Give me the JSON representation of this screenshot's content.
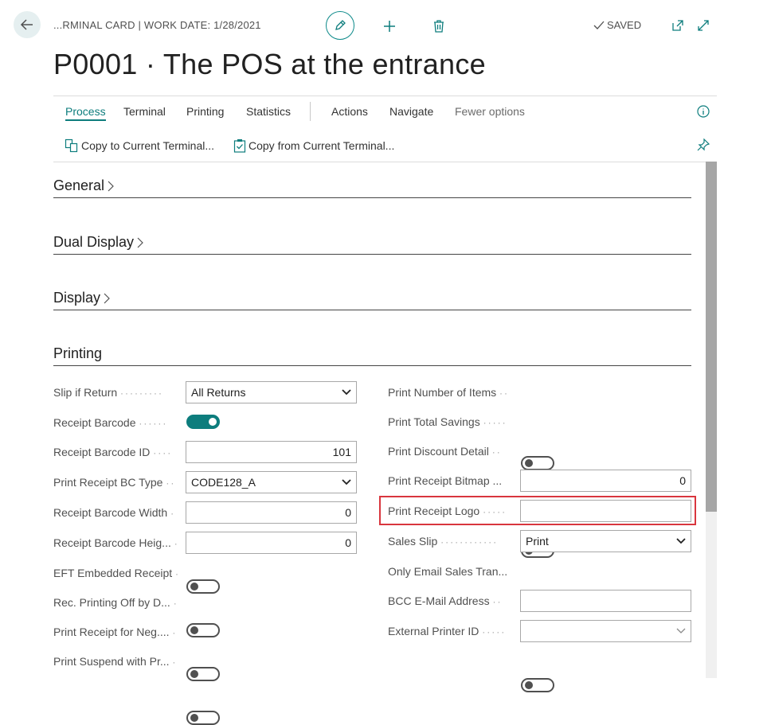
{
  "header": {
    "breadcrumb": "...RMINAL CARD | WORK DATE: 1/28/2021",
    "saved_label": "SAVED",
    "title": "P0001 · The POS at the entrance"
  },
  "menu": {
    "items": [
      "Process",
      "Terminal",
      "Printing",
      "Statistics",
      "Actions",
      "Navigate",
      "Fewer options"
    ],
    "active": "Process"
  },
  "actions": {
    "copy_to": "Copy to Current Terminal...",
    "copy_from": "Copy from Current Terminal..."
  },
  "sections": {
    "general": "General",
    "dual_display": "Dual Display",
    "display": "Display",
    "printing": "Printing"
  },
  "printing_left": [
    {
      "label": "Slip if Return",
      "type": "select",
      "value": "All Returns"
    },
    {
      "label": "Receipt Barcode",
      "type": "toggle",
      "value": "on"
    },
    {
      "label": "Receipt Barcode ID",
      "type": "number",
      "value": "101"
    },
    {
      "label": "Print Receipt BC Type",
      "type": "select",
      "value": "CODE128_A"
    },
    {
      "label": "Receipt Barcode Width",
      "type": "number",
      "value": "0"
    },
    {
      "label": "Receipt Barcode Heig...",
      "type": "number",
      "value": "0"
    },
    {
      "label": "EFT Embedded Receipt",
      "type": "toggle",
      "value": "off"
    },
    {
      "label": "Rec. Printing Off by D...",
      "type": "toggle",
      "value": "off"
    },
    {
      "label": "Print Receipt for Neg....",
      "type": "toggle",
      "value": "off"
    },
    {
      "label": "Print Suspend with Pr...",
      "type": "toggle",
      "value": "off"
    }
  ],
  "printing_right": [
    {
      "label": "Print Number of Items",
      "type": "toggle",
      "value": "off"
    },
    {
      "label": "Print Total Savings",
      "type": "toggle",
      "value": "off"
    },
    {
      "label": "Print Discount Detail",
      "type": "toggle",
      "value": "off"
    },
    {
      "label": "Print Receipt Bitmap ...",
      "type": "number",
      "value": "0"
    },
    {
      "label": "Print Receipt Logo",
      "type": "text",
      "value": ""
    },
    {
      "label": "Sales Slip",
      "type": "select",
      "value": "Print"
    },
    {
      "label": "Only Email Sales Tran...",
      "type": "toggle",
      "value": "off"
    },
    {
      "label": "BCC E-Mail Address",
      "type": "text",
      "value": ""
    },
    {
      "label": "External Printer ID",
      "type": "select",
      "value": ""
    }
  ],
  "colors": {
    "accent": "#0d7d7d",
    "highlight": "#d9363e"
  }
}
